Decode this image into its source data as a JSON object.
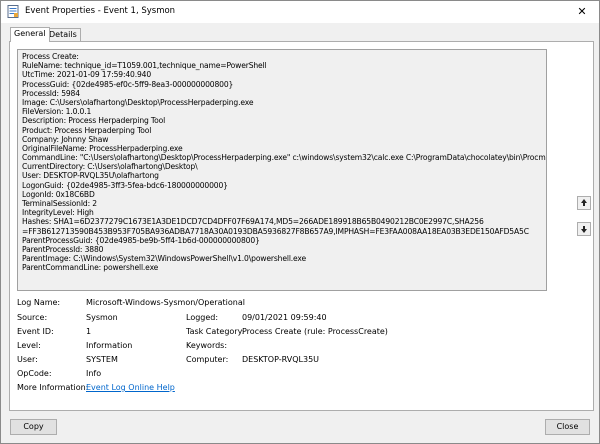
{
  "window": {
    "title": "Event Properties - Event 1, Sysmon",
    "close_glyph": "✕"
  },
  "tabs": [
    {
      "label": "General",
      "active": true
    },
    {
      "label": "Details",
      "active": false
    }
  ],
  "description_lines": [
    "Process Create:",
    "RuleName: technique_id=T1059.001,technique_name=PowerShell",
    "UtcTime: 2021-01-09 17:59:40.940",
    "ProcessGuid: {02de4985-ef0c-5ff9-8ea3-000000000800}",
    "ProcessId: 5984",
    "Image: C:\\Users\\olafhartong\\Desktop\\ProcessHerpaderping.exe",
    "FileVersion: 1.0.0.1",
    "Description: Process Herpaderping Tool",
    "Product: Process Herpaderping Tool",
    "Company: Johnny Shaw",
    "OriginalFileName: ProcessHerpaderping.exe",
    "CommandLine: \"C:\\Users\\olafhartong\\Desktop\\ProcessHerpaderping.exe\" c:\\windows\\system32\\calc.exe C:\\ProgramData\\chocolatey\\bin\\Procmon.exe",
    "CurrentDirectory: C:\\Users\\olafhartong\\Desktop\\",
    "User: DESKTOP-RVQL35U\\olafhartong",
    "LogonGuid: {02de4985-3ff3-5fea-bdc6-180000000000}",
    "LogonId: 0x18C6BD",
    "TerminalSessionId: 2",
    "IntegrityLevel: High",
    "Hashes: SHA1=6D2377279C1673E1A3DE1DCD7CD4DFF07F69A174,MD5=266ADE189918B65B0490212BC0E2997C,SHA256",
    "=FF3B612713590B453B953F705BA936ADBA7718A30A0193DBA5936827F8B657A9,IMPHASH=FE3FAA008AA18EA03B3EDE150AFD5A5C",
    "ParentProcessGuid: {02de4985-be9b-5ff4-1b6d-000000000800}",
    "ParentProcessId: 3880",
    "ParentImage: C:\\Windows\\System32\\WindowsPowerShell\\v1.0\\powershell.exe",
    "ParentCommandLine: powershell.exe"
  ],
  "fields": {
    "log_name": {
      "label": "Log Name:",
      "value": "Microsoft-Windows-Sysmon/Operational"
    },
    "source": {
      "label": "Source:",
      "value": "Sysmon"
    },
    "logged": {
      "label": "Logged:",
      "value": "09/01/2021 09:59:40"
    },
    "event_id": {
      "label": "Event ID:",
      "value": "1"
    },
    "task_category": {
      "label": "Task Category:",
      "value": "Process Create (rule: ProcessCreate)"
    },
    "level": {
      "label": "Level:",
      "value": "Information"
    },
    "keywords": {
      "label": "Keywords:",
      "value": ""
    },
    "user": {
      "label": "User:",
      "value": "SYSTEM"
    },
    "computer": {
      "label": "Computer:",
      "value": "DESKTOP-RVQL35U"
    },
    "opcode": {
      "label": "OpCode:",
      "value": "Info"
    },
    "more_info": {
      "label": "More Information:",
      "value": "Event Log Online Help"
    }
  },
  "buttons": {
    "copy": "Copy",
    "close": "Close"
  },
  "icons": {
    "title": "event-viewer-icon",
    "scroll_up": "arrow-up-icon",
    "scroll_down": "arrow-down-icon"
  }
}
